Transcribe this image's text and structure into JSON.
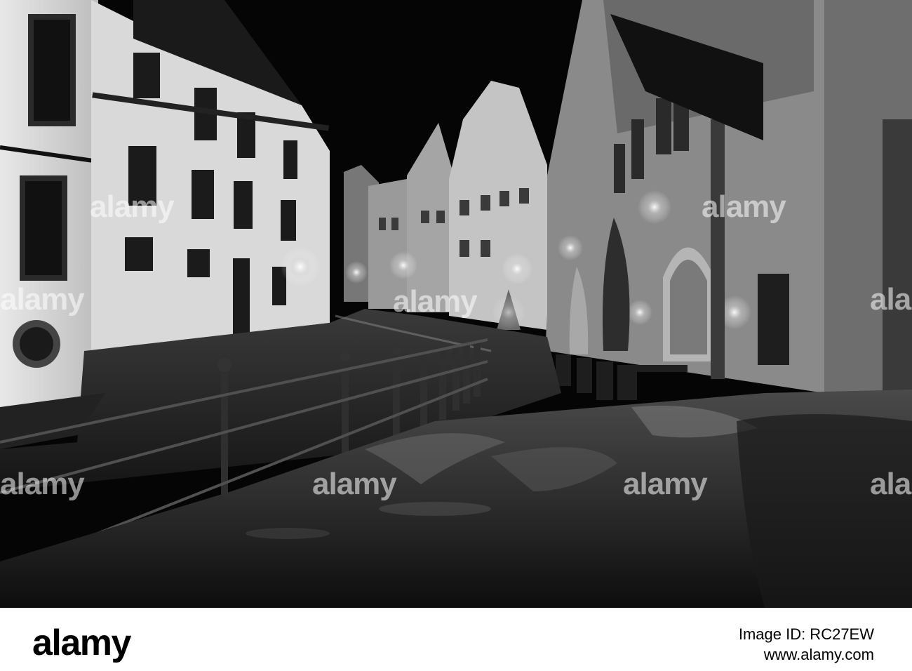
{
  "photo": {
    "watermarks": [
      "alamy",
      "alamy",
      "alamy",
      "alamy",
      "alamy",
      "alamy",
      "alamy",
      "alamy",
      "alamy"
    ]
  },
  "footer": {
    "logo": "alamy",
    "image_id": "Image ID: RC27EW",
    "site": "www.alamy.com"
  }
}
